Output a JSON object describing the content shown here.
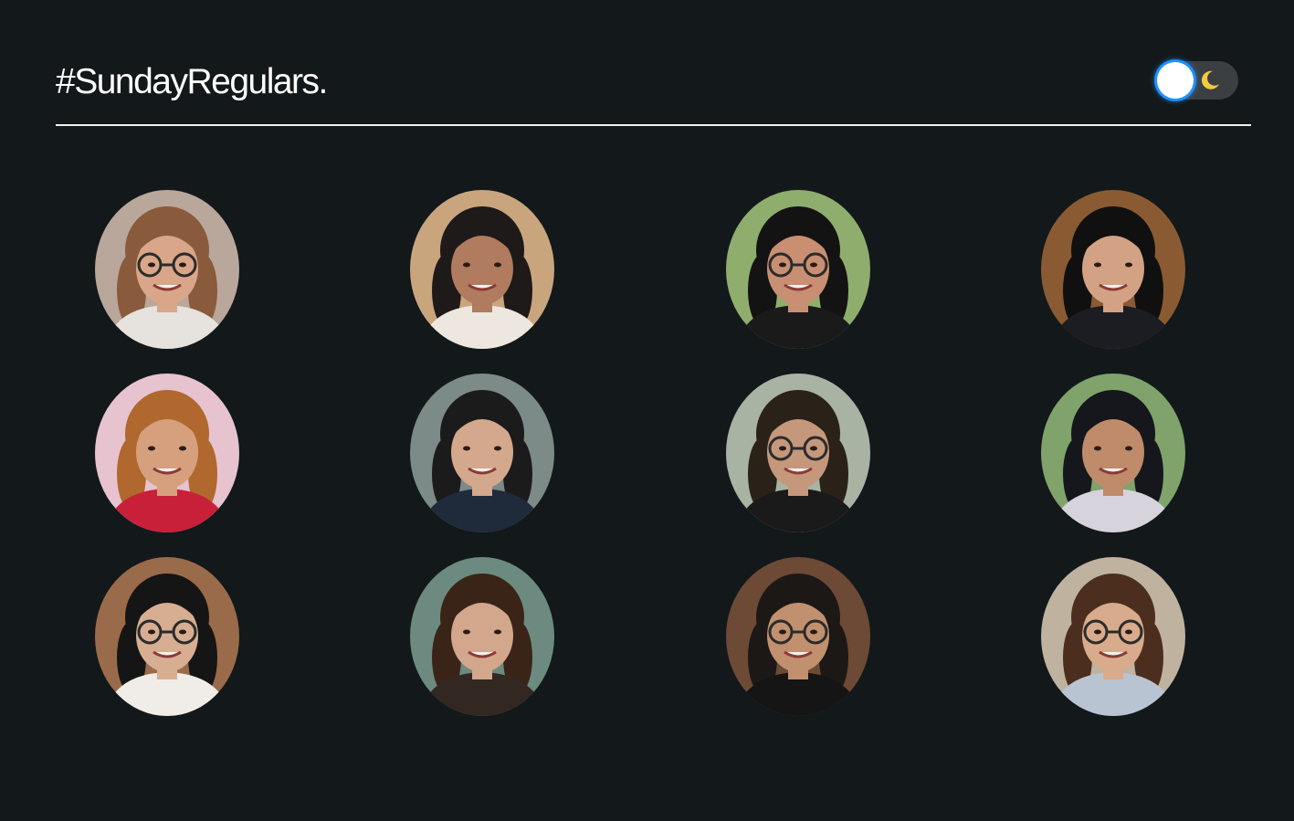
{
  "header": {
    "title": "#SundayRegulars."
  },
  "theme_toggle": {
    "state": "dark",
    "knob_color": "#ffffff",
    "focus_ring_color": "#1e90ff",
    "icon": "moon-icon"
  },
  "colors": {
    "background": "#13181b",
    "divider": "#f2f2f2",
    "track": "#3b3f42"
  },
  "members": [
    {
      "icon": "person-photo",
      "bg": "#b8a79a",
      "skin": "#d9a68a",
      "hair": "#8a5a3c",
      "shirt": "#e6e2dd",
      "glasses": true
    },
    {
      "icon": "person-photo",
      "bg": "#c9a57e",
      "skin": "#b07b5e",
      "hair": "#1d1a19",
      "shirt": "#ede7df",
      "glasses": false
    },
    {
      "icon": "person-photo",
      "bg": "#8fae6e",
      "skin": "#c98f73",
      "hair": "#141313",
      "shirt": "#1a1a1a",
      "glasses": true
    },
    {
      "icon": "person-photo",
      "bg": "#8a5b32",
      "skin": "#d3a284",
      "hair": "#101010",
      "shirt": "#1b1d22",
      "glasses": false
    },
    {
      "icon": "person-photo",
      "bg": "#e7c3d0",
      "skin": "#d6a07e",
      "hair": "#b0682e",
      "shirt": "#c9203a",
      "glasses": false
    },
    {
      "icon": "person-photo",
      "bg": "#7c8a88",
      "skin": "#d4a88c",
      "hair": "#1b1b1b",
      "shirt": "#1f2a3a",
      "glasses": false
    },
    {
      "icon": "person-photo",
      "bg": "#a9b3a4",
      "skin": "#c5987c",
      "hair": "#2a2219",
      "shirt": "#1a1a1a",
      "glasses": true
    },
    {
      "icon": "person-photo",
      "bg": "#7fa36b",
      "skin": "#c08b6a",
      "hair": "#15171c",
      "shirt": "#d7d3dc",
      "glasses": false
    },
    {
      "icon": "person-photo",
      "bg": "#9a6b4a",
      "skin": "#d7ae92",
      "hair": "#151515",
      "shirt": "#f0ede8",
      "glasses": true
    },
    {
      "icon": "person-photo",
      "bg": "#6c8a7f",
      "skin": "#d3a78c",
      "hair": "#3a2417",
      "shirt": "#332722",
      "glasses": false
    },
    {
      "icon": "person-photo",
      "bg": "#6d4a35",
      "skin": "#c1906f",
      "hair": "#1c1816",
      "shirt": "#151515",
      "glasses": true
    },
    {
      "icon": "person-photo",
      "bg": "#bfb3a0",
      "skin": "#d8ab8c",
      "hair": "#4b2e1d",
      "shirt": "#b9c4d3",
      "glasses": true
    }
  ]
}
